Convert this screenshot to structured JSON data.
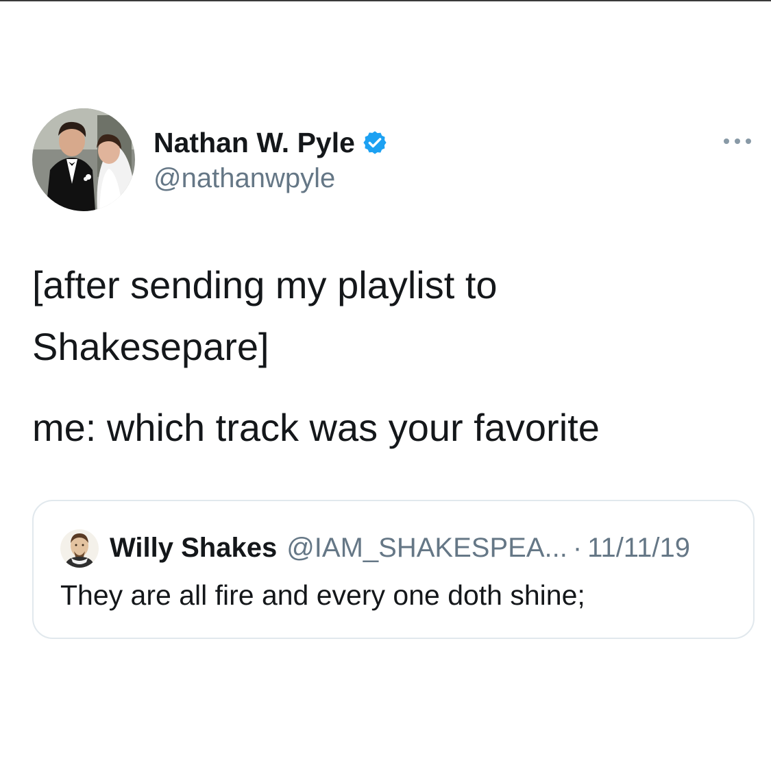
{
  "tweet": {
    "author": {
      "display_name": "Nathan W. Pyle",
      "handle": "@nathanwpyle",
      "verified": true,
      "avatar_icon": "profile-photo"
    },
    "more_icon": "ellipsis-icon",
    "text_lines": [
      "[after sending my playlist to",
      "Shakesepare]",
      "me: which track was your favorite"
    ]
  },
  "quoted_tweet": {
    "author": {
      "display_name": "Willy Shakes",
      "handle": "@IAM_SHAKESPEA...",
      "avatar_icon": "shakespeare-portrait"
    },
    "separator": "·",
    "date": "11/11/19",
    "text": "They are all fire and every one doth shine;"
  },
  "colors": {
    "text_primary": "#14171a",
    "text_secondary": "#657786",
    "verified_blue": "#1da1f2",
    "border": "#e1e8ed"
  }
}
